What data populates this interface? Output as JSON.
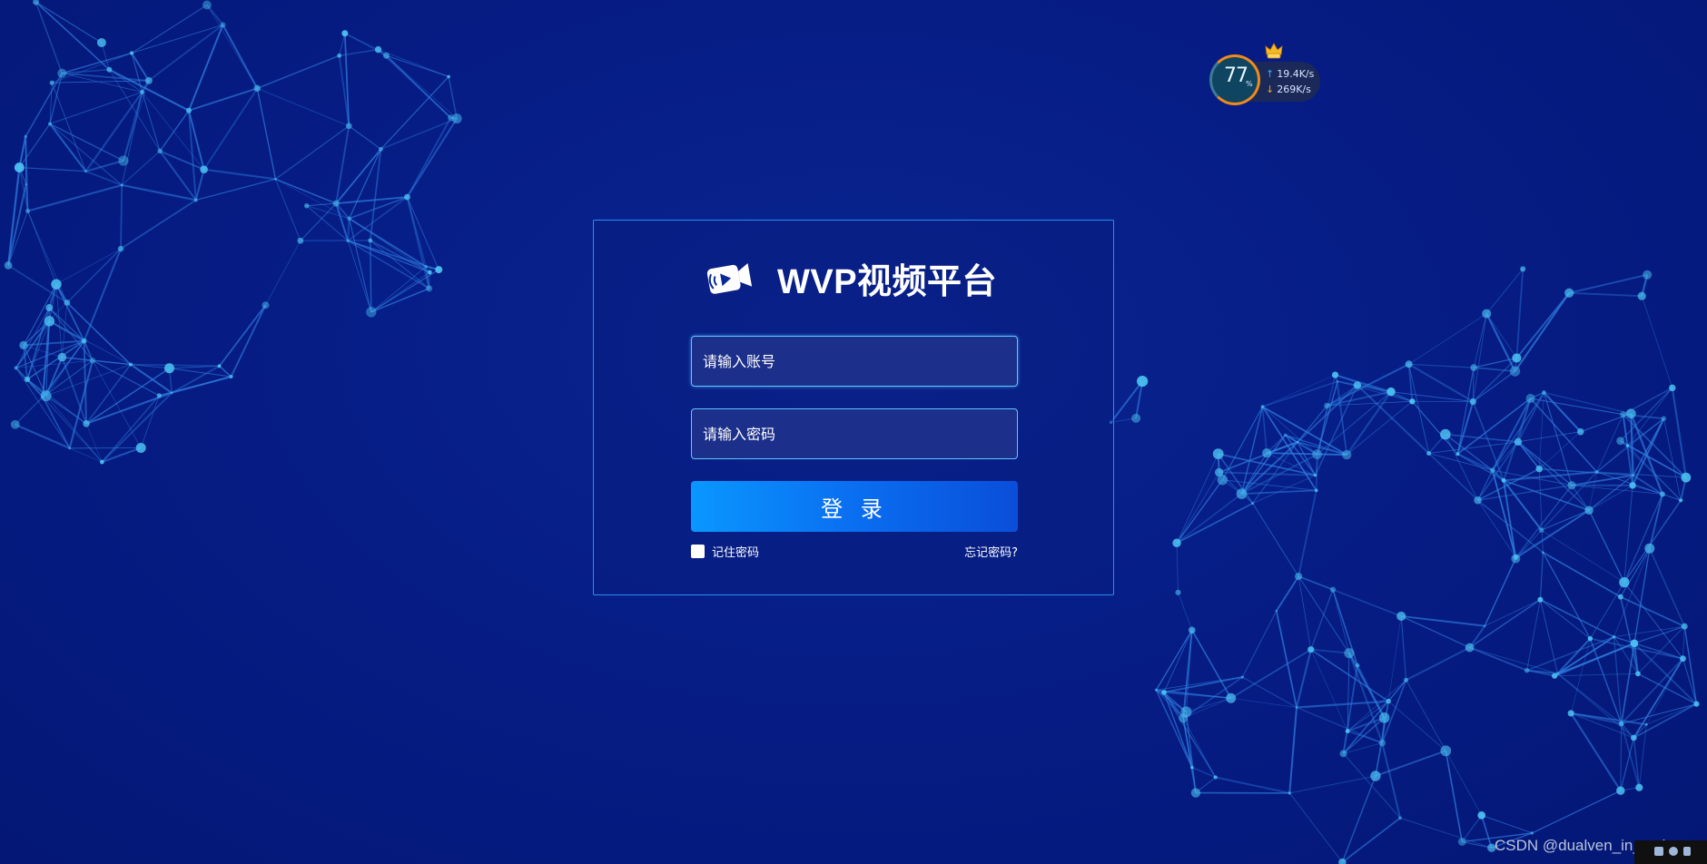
{
  "brand": {
    "title": "WVP视频平台",
    "logo_icon": "video-camera-icon"
  },
  "login_form": {
    "username_placeholder": "请输入账号",
    "username_value": "",
    "password_placeholder": "请输入密码",
    "password_value": "",
    "submit_label": "登 录",
    "remember_label": "记住密码",
    "remember_checked": false,
    "forgot_label": "忘记密码?"
  },
  "speed_widget": {
    "percent": "77",
    "percent_unit": "%",
    "upload": "19.4K/s",
    "download": "269K/s",
    "badge_icon": "vip-crown-icon"
  },
  "watermark": "CSDN @dualven_in_csdn",
  "colors": {
    "background": "#061d86",
    "card_border": "#2a8ef0",
    "input_bg": "#1c2f8a",
    "input_border": "#5fc7ff",
    "button_start": "#0a97ff",
    "button_end": "#0a4ed9",
    "network_lines": "#2f7fe0",
    "network_nodes": "#4cc2f2"
  }
}
